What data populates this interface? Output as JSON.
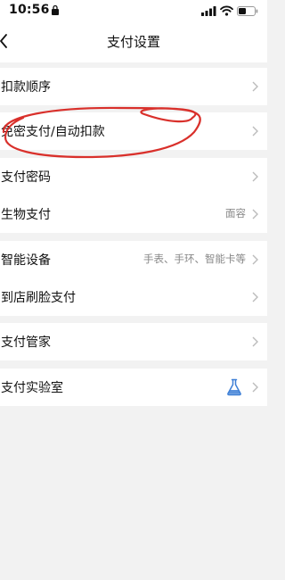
{
  "status_bar": {
    "time": "10:56"
  },
  "nav": {
    "title": "支付设置",
    "back_icon": "chevron-left-icon"
  },
  "groups": [
    {
      "rows": [
        {
          "label": "扣款顺序",
          "value": ""
        }
      ]
    },
    {
      "rows": [
        {
          "label": "免密支付/自动扣款",
          "value": ""
        }
      ]
    },
    {
      "rows": [
        {
          "label": "支付密码",
          "value": ""
        },
        {
          "label": "生物支付",
          "value": "面容"
        }
      ]
    },
    {
      "rows": [
        {
          "label": "智能设备",
          "value": "手表、手环、智能卡等"
        },
        {
          "label": "到店刷脸支付",
          "value": ""
        }
      ]
    },
    {
      "rows": [
        {
          "label": "支付管家",
          "value": ""
        }
      ]
    },
    {
      "rows": [
        {
          "label": "支付实验室",
          "value": "",
          "icon": "flask-icon"
        }
      ]
    }
  ],
  "colors": {
    "background": "#f2f2f2",
    "row_bg": "#ffffff",
    "secondary_text": "#888888",
    "annotation_red": "#d9302b",
    "flask_blue": "#3d7fd6"
  }
}
